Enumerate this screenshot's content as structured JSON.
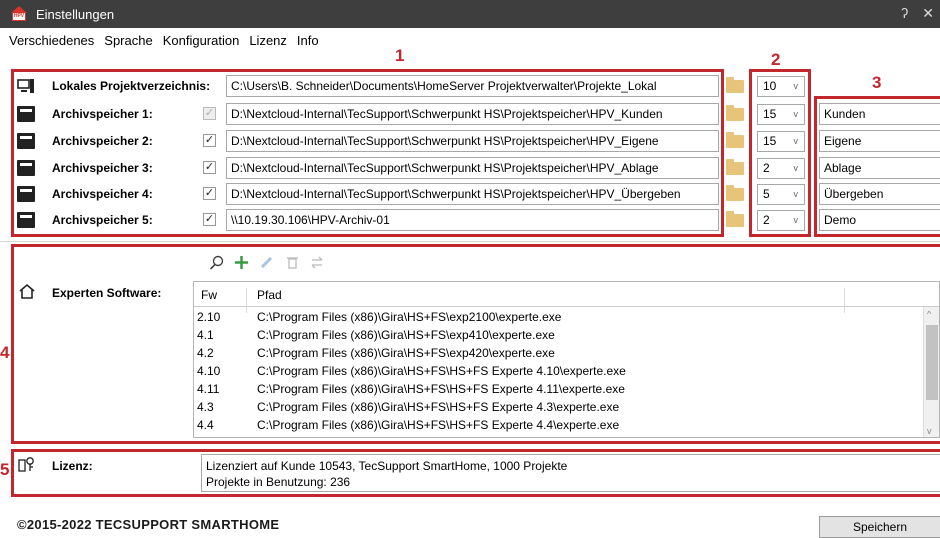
{
  "window": {
    "title": "Einstellungen",
    "help_glyph": "ʔ",
    "close_glyph": "✕"
  },
  "menu": [
    "Verschiedenes",
    "Sprache",
    "Konfiguration",
    "Lizenz",
    "Info"
  ],
  "annotations": [
    "1",
    "2",
    "3",
    "4",
    "5"
  ],
  "project_dir": {
    "label": "Lokales Projektverzeichnis:",
    "path": "C:\\Users\\B. Schneider\\Documents\\HomeServer Projektverwalter\\Projekte_Lokal",
    "count": "10"
  },
  "archives": [
    {
      "label": "Archivspeicher 1:",
      "checked": "✓",
      "path": "D:\\Nextcloud-Internal\\TecSupport\\Schwerpunkt HS\\Projektspeicher\\HPV_Kunden",
      "count": "15",
      "name": "Kunden"
    },
    {
      "label": "Archivspeicher 2:",
      "checked": "✓",
      "path": "D:\\Nextcloud-Internal\\TecSupport\\Schwerpunkt HS\\Projektspeicher\\HPV_Eigene",
      "count": "15",
      "name": "Eigene"
    },
    {
      "label": "Archivspeicher 3:",
      "checked": "✓",
      "path": "D:\\Nextcloud-Internal\\TecSupport\\Schwerpunkt HS\\Projektspeicher\\HPV_Ablage",
      "count": "2",
      "name": "Ablage"
    },
    {
      "label": "Archivspeicher 4:",
      "checked": "✓",
      "path": "D:\\Nextcloud-Internal\\TecSupport\\Schwerpunkt HS\\Projektspeicher\\HPV_Übergeben",
      "count": "5",
      "name": "Übergeben"
    },
    {
      "label": "Archivspeicher 5:",
      "checked": "✓",
      "path": "\\\\10.19.30.106\\HPV-Archiv-01",
      "count": "2",
      "name": "Demo"
    }
  ],
  "experts": {
    "label": "Experten Software:",
    "columns": [
      "Fw",
      "Pfad"
    ],
    "rows": [
      {
        "fw": "2.10",
        "path": "C:\\Program Files (x86)\\Gira\\HS+FS\\exp2100\\experte.exe"
      },
      {
        "fw": "4.1",
        "path": "C:\\Program Files (x86)\\Gira\\HS+FS\\exp410\\experte.exe"
      },
      {
        "fw": "4.2",
        "path": "C:\\Program Files (x86)\\Gira\\HS+FS\\exp420\\experte.exe"
      },
      {
        "fw": "4.10",
        "path": "C:\\Program Files (x86)\\Gira\\HS+FS\\HS+FS Experte 4.10\\experte.exe"
      },
      {
        "fw": "4.11",
        "path": "C:\\Program Files (x86)\\Gira\\HS+FS\\HS+FS Experte 4.11\\experte.exe"
      },
      {
        "fw": "4.3",
        "path": "C:\\Program Files (x86)\\Gira\\HS+FS\\HS+FS Experte 4.3\\experte.exe"
      },
      {
        "fw": "4.4",
        "path": "C:\\Program Files (x86)\\Gira\\HS+FS\\HS+FS Experte 4.4\\experte.exe"
      }
    ]
  },
  "license": {
    "label": "Lizenz:",
    "line1": "Lizenziert auf Kunde 10543, TecSupport SmartHome, 1000 Projekte",
    "line2": "Projekte in Benutzung: 236"
  },
  "footer": {
    "copyright": "©2015-2022 TECSUPPORT SMARTHOME",
    "save": "Speichern"
  },
  "colors": {
    "accent_red": "#c3262d",
    "titlebar": "#3e3e3e",
    "folder": "#e8c37a"
  }
}
